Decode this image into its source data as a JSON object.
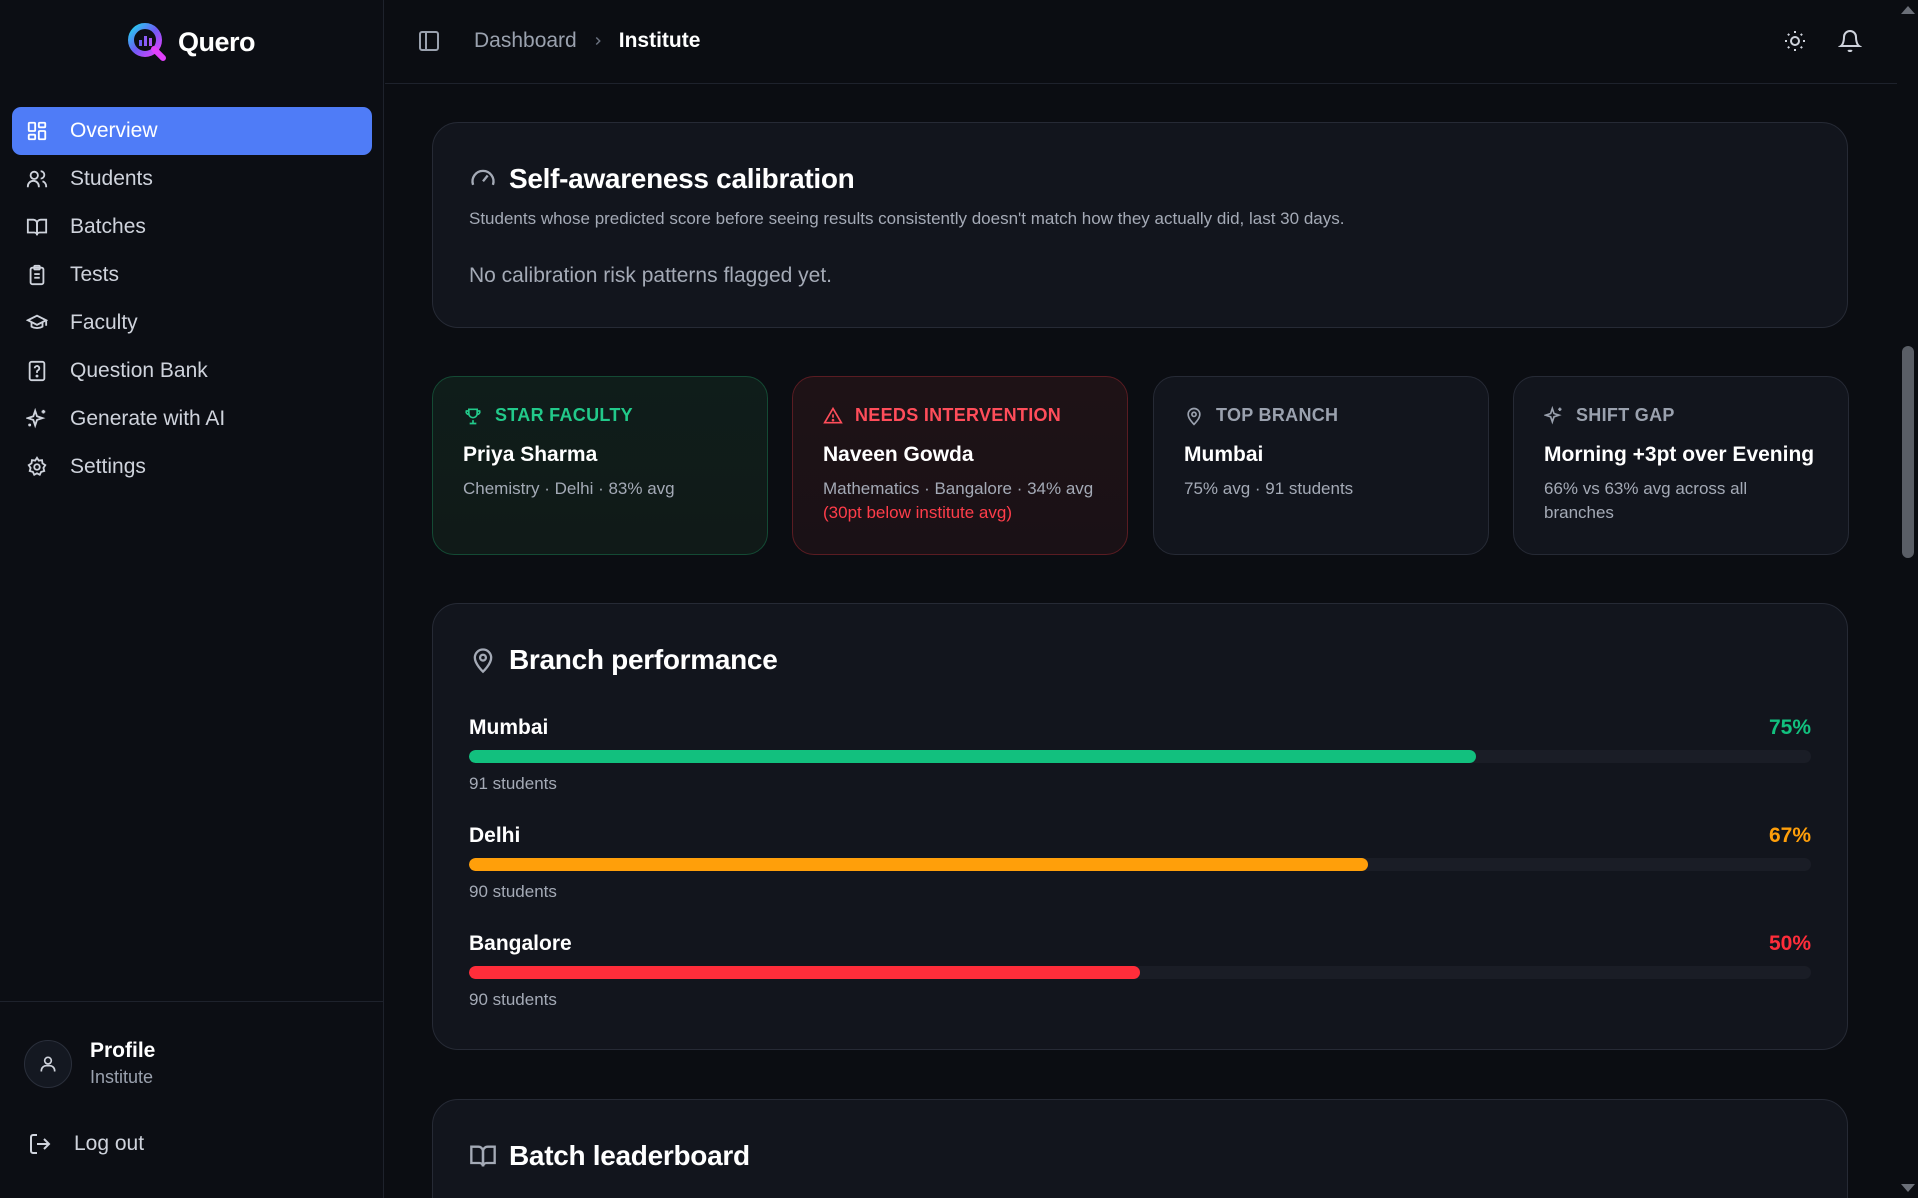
{
  "app": {
    "name": "Quero"
  },
  "sidebar": {
    "items": [
      {
        "label": "Overview",
        "icon": "layout-grid-icon",
        "active": true
      },
      {
        "label": "Students",
        "icon": "users-icon",
        "active": false
      },
      {
        "label": "Batches",
        "icon": "book-open-icon",
        "active": false
      },
      {
        "label": "Tests",
        "icon": "clipboard-icon",
        "active": false
      },
      {
        "label": "Faculty",
        "icon": "graduation-cap-icon",
        "active": false
      },
      {
        "label": "Question Bank",
        "icon": "file-question-icon",
        "active": false
      },
      {
        "label": "Generate with AI",
        "icon": "sparkles-icon",
        "active": false
      },
      {
        "label": "Settings",
        "icon": "gear-icon",
        "active": false
      }
    ],
    "profile": {
      "name": "Profile",
      "role": "Institute"
    },
    "logout_label": "Log out"
  },
  "header": {
    "breadcrumb": {
      "parent": "Dashboard",
      "current": "Institute"
    }
  },
  "calibration": {
    "title": "Self-awareness calibration",
    "description": "Students whose predicted score before seeing results consistently doesn't match how they actually did, last 30 days.",
    "empty_text": "No calibration risk patterns flagged yet."
  },
  "stats": [
    {
      "label": "STAR FACULTY",
      "main": "Priya Sharma",
      "sub": "Chemistry · Delhi · 83% avg",
      "color": "#22c98a",
      "icon": "trophy-icon"
    },
    {
      "label": "NEEDS INTERVENTION",
      "main": "Naveen Gowda",
      "sub": "Mathematics · Bangalore · 34% avg",
      "sub_highlight": "(30pt below institute avg)",
      "color": "#ff4d5a",
      "icon": "alert-triangle-icon"
    },
    {
      "label": "TOP BRANCH",
      "main": "Mumbai",
      "sub": "75% avg · 91 students",
      "color": "#9aa1ae",
      "icon": "map-pin-icon"
    },
    {
      "label": "SHIFT GAP",
      "main": "Morning +3pt over Evening",
      "sub": "66% vs 63% avg across all branches",
      "color": "#9aa1ae",
      "icon": "sparkles-icon"
    }
  ],
  "branch_performance": {
    "title": "Branch performance",
    "branches": [
      {
        "name": "Mumbai",
        "percent_label": "75%",
        "value": 75,
        "students": "91 students",
        "color": "#12c07e"
      },
      {
        "name": "Delhi",
        "percent_label": "67%",
        "value": 67,
        "students": "90 students",
        "color": "#ff9f0a"
      },
      {
        "name": "Bangalore",
        "percent_label": "50%",
        "value": 50,
        "students": "90 students",
        "color": "#ff2d3a"
      }
    ]
  },
  "batch_leaderboard": {
    "title": "Batch leaderboard"
  }
}
